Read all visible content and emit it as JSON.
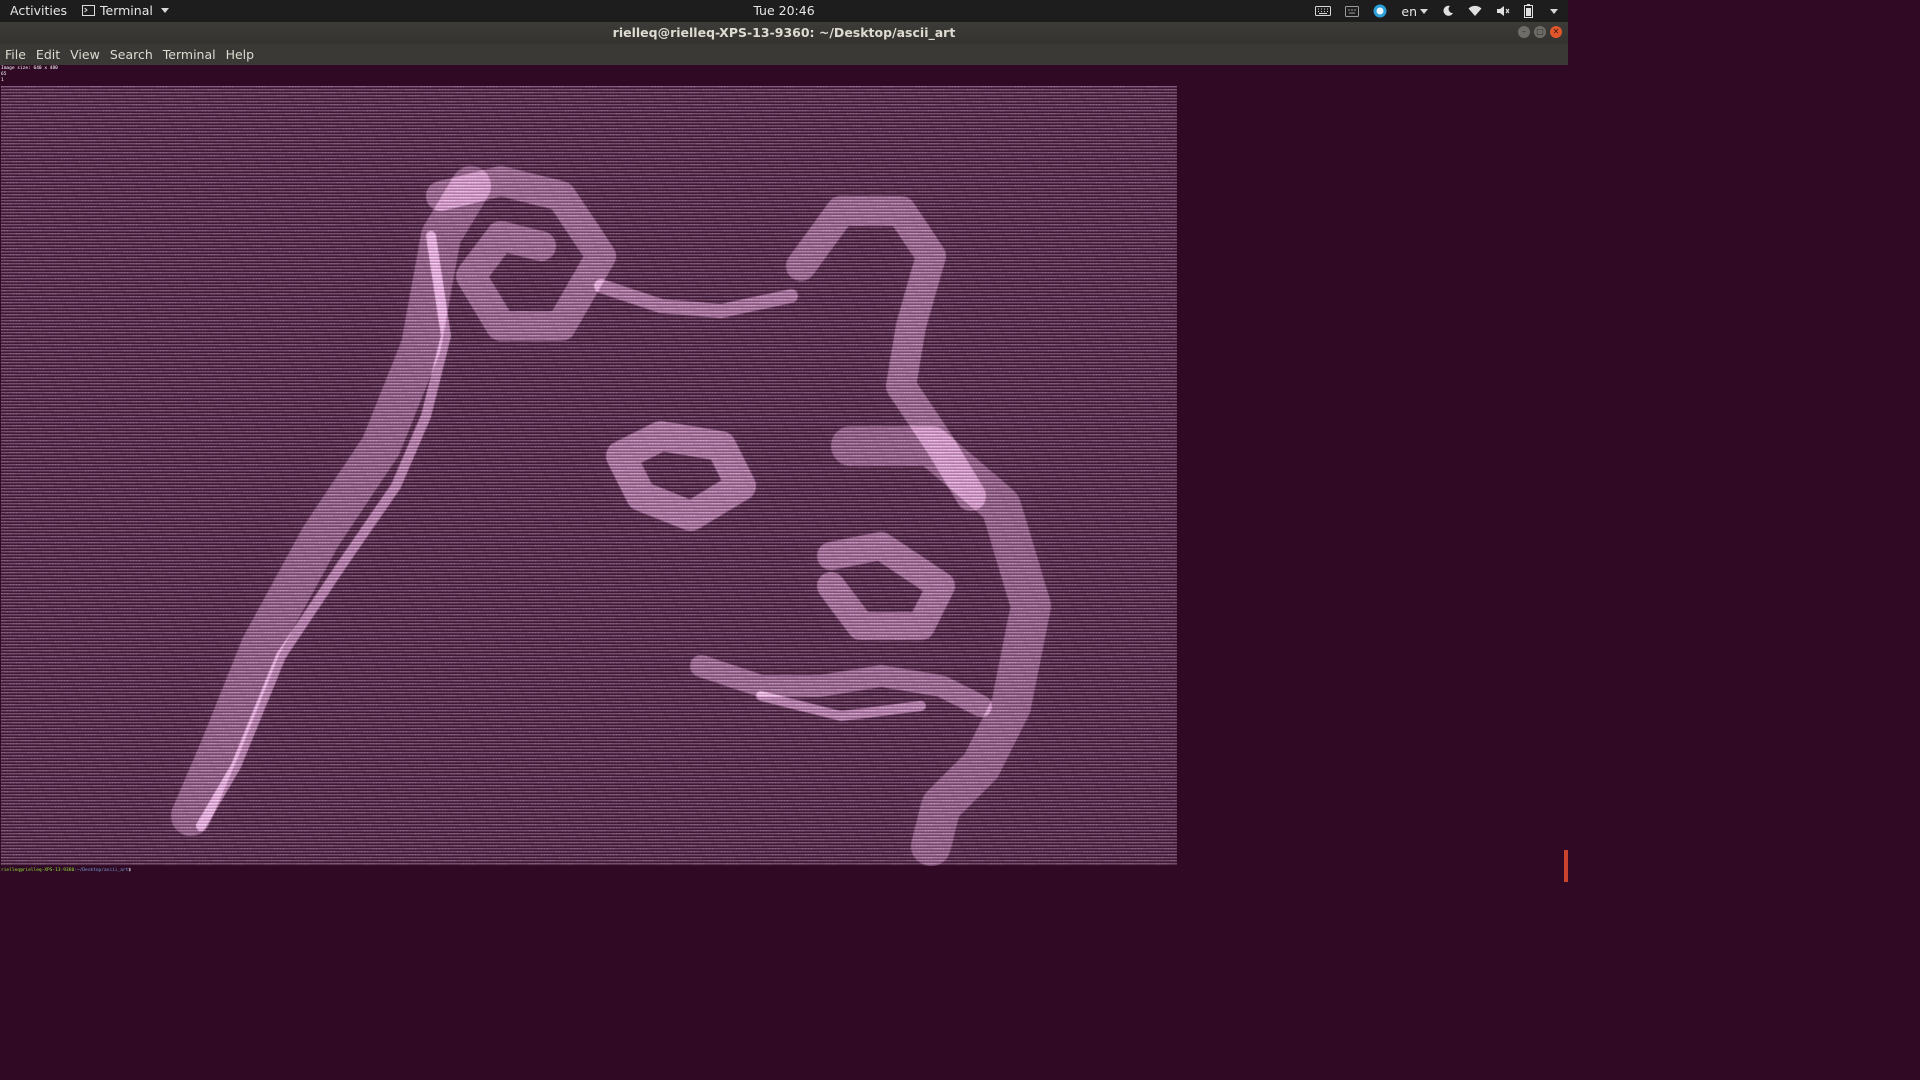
{
  "topbar": {
    "activities": "Activities",
    "app_name": "Terminal",
    "clock": "Tue 20:46",
    "language": "en"
  },
  "window": {
    "title": "rielleq@rielleq-XPS-13-9360: ~/Desktop/ascii_art"
  },
  "menubar": {
    "items": [
      "File",
      "Edit",
      "View",
      "Search",
      "Terminal",
      "Help"
    ]
  },
  "terminal": {
    "output_lines": [
      "Image size: 640 x 480",
      "65",
      "1"
    ],
    "prompt_user": "rielleq@rielleq-XPS-13-9360",
    "prompt_path": ":~/Desktop/ascii_art",
    "prompt_symbol": "$ ",
    "background_color": "#300a24",
    "ascii_color": "#d9b3d9"
  },
  "icons": [
    "terminal-icon",
    "keyboard-icon",
    "screen-keyboard-icon",
    "skype-icon",
    "night-light-icon",
    "wifi-icon",
    "volume-muted-icon",
    "battery-icon",
    "system-menu-icon"
  ]
}
